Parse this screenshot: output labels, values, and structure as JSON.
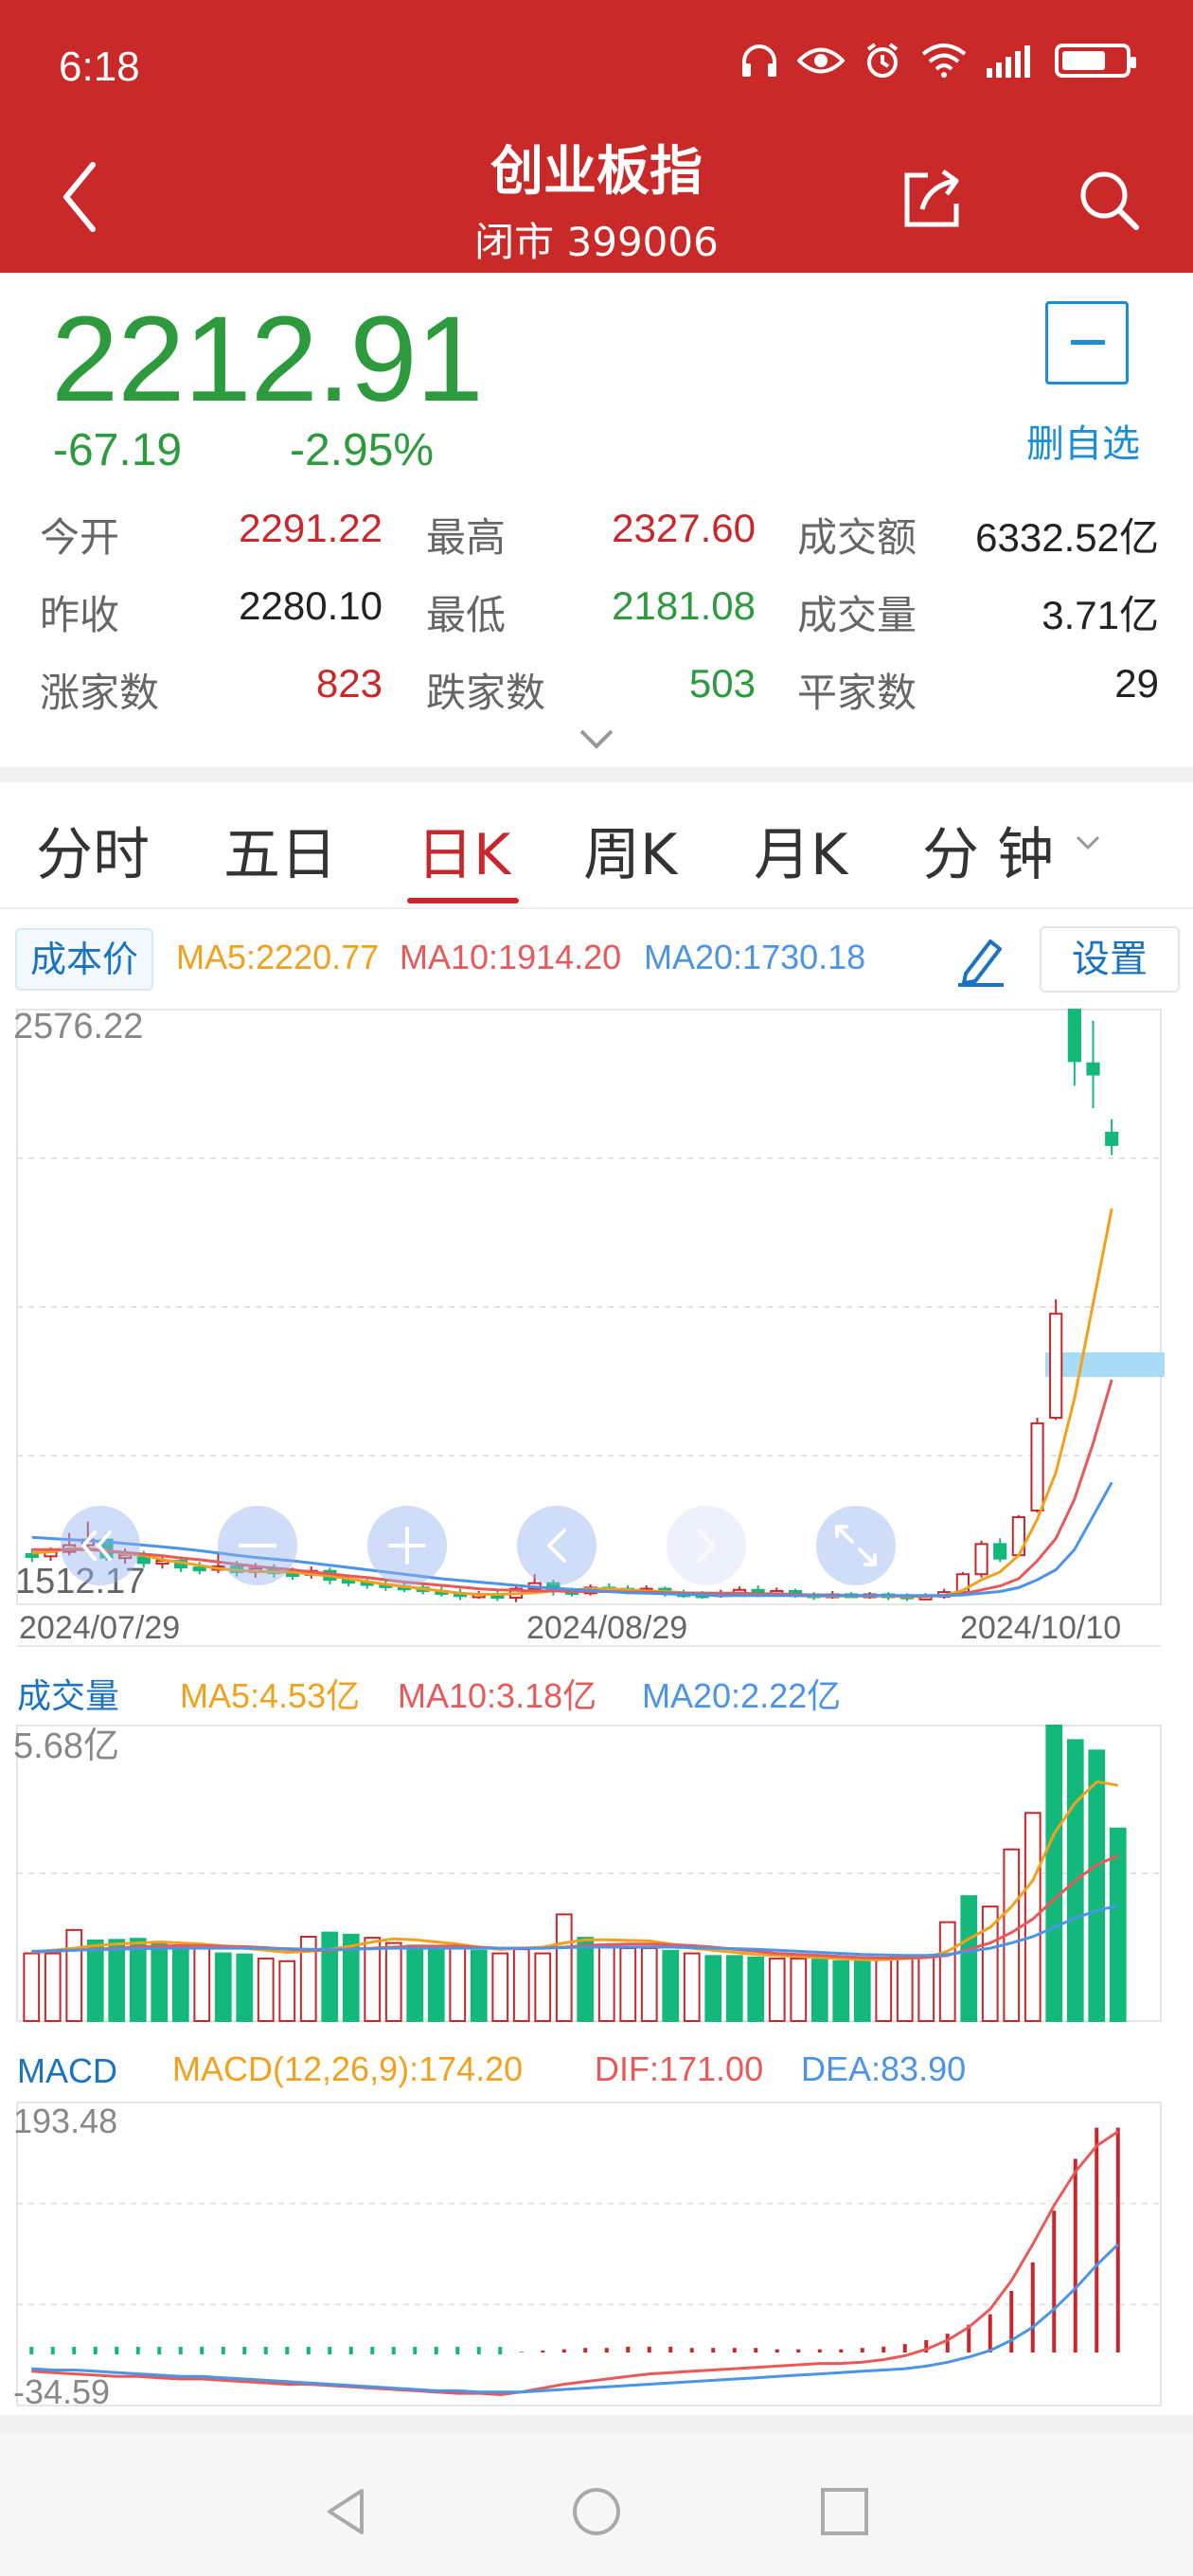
{
  "status": {
    "time": "6:18",
    "battery_level": 0.7
  },
  "nav": {
    "title": "创业板指",
    "subtitle": "闭市 399006",
    "back_icon": "chevron-left-icon",
    "share_icon": "share-icon",
    "search_icon": "search-icon"
  },
  "quote": {
    "price": "2212.91",
    "change": "-67.19",
    "change_pct": "-2.95%",
    "watch_label": "删自选"
  },
  "stats": [
    {
      "label": "今开",
      "value": "2291.22",
      "color": "#c8282c"
    },
    {
      "label": "最高",
      "value": "2327.60",
      "color": "#c8282c"
    },
    {
      "label": "成交额",
      "value": "6332.52亿",
      "color": "#222222"
    },
    {
      "label": "昨收",
      "value": "2280.10",
      "color": "#222222"
    },
    {
      "label": "最低",
      "value": "2181.08",
      "color": "#2e9a3e"
    },
    {
      "label": "成交量",
      "value": "3.71亿",
      "color": "#222222"
    },
    {
      "label": "涨家数",
      "value": "823",
      "color": "#c8282c"
    },
    {
      "label": "跌家数",
      "value": "503",
      "color": "#2e9a3e"
    },
    {
      "label": "平家数",
      "value": "29",
      "color": "#222222"
    }
  ],
  "tabs": [
    "分时",
    "五日",
    "日K",
    "周K",
    "月K",
    "分 钟"
  ],
  "active_tab": 2,
  "toolbar": {
    "cost_label": "成本价",
    "ma5": "MA5:2220.77",
    "ma10": "MA10:1914.20",
    "ma20": "MA20:1730.18",
    "settings_label": "设置"
  },
  "volume_header": {
    "label": "成交量",
    "ma5": "MA5:4.53亿",
    "ma10": "MA10:3.18亿",
    "ma20": "MA20:2.22亿"
  },
  "macd_header": {
    "label": "MACD",
    "macd": "MACD(12,26,9):174.20",
    "dif": "DIF:171.00",
    "dea": "DEA:83.90"
  },
  "colors": {
    "up": "#c8282c",
    "down": "#13b97a",
    "ma5": "#f2a11e",
    "ma10": "#e85a5a",
    "ma20": "#4b94e6",
    "header_bg": "#c92a29"
  },
  "chart_data": [
    {
      "type": "candlestick",
      "title": "",
      "y_max_label": "2576.22",
      "y_min_label": "1512.17",
      "ylim": [
        1512.17,
        2576.22
      ],
      "x_ticks": [
        "2024/07/29",
        "2024/08/29",
        "2024/10/10"
      ],
      "candles": [
        [
          1602,
          1598,
          1612,
          1588
        ],
        [
          1598,
          1606,
          1614,
          1590
        ],
        [
          1606,
          1618,
          1640,
          1600
        ],
        [
          1618,
          1628,
          1660,
          1610
        ],
        [
          1628,
          1596,
          1640,
          1590
        ],
        [
          1596,
          1600,
          1612,
          1585
        ],
        [
          1600,
          1586,
          1608,
          1578
        ],
        [
          1586,
          1590,
          1600,
          1576
        ],
        [
          1590,
          1578,
          1598,
          1570
        ],
        [
          1578,
          1574,
          1588,
          1566
        ],
        [
          1574,
          1580,
          1602,
          1568
        ],
        [
          1580,
          1570,
          1590,
          1562
        ],
        [
          1570,
          1576,
          1586,
          1560
        ],
        [
          1576,
          1568,
          1584,
          1560
        ],
        [
          1568,
          1565,
          1578,
          1556
        ],
        [
          1565,
          1572,
          1580,
          1558
        ],
        [
          1572,
          1556,
          1578,
          1548
        ],
        [
          1556,
          1552,
          1566,
          1544
        ],
        [
          1552,
          1548,
          1560,
          1540
        ],
        [
          1548,
          1544,
          1556,
          1536
        ],
        [
          1544,
          1542,
          1552,
          1534
        ],
        [
          1542,
          1536,
          1550,
          1530
        ],
        [
          1536,
          1532,
          1544,
          1526
        ],
        [
          1532,
          1528,
          1540,
          1520
        ],
        [
          1528,
          1530,
          1536,
          1522
        ],
        [
          1530,
          1524,
          1536,
          1518
        ],
        [
          1524,
          1540,
          1548,
          1516
        ],
        [
          1540,
          1550,
          1566,
          1534
        ],
        [
          1550,
          1536,
          1556,
          1528
        ],
        [
          1536,
          1532,
          1542,
          1526
        ],
        [
          1532,
          1542,
          1548,
          1528
        ],
        [
          1542,
          1540,
          1550,
          1534
        ],
        [
          1540,
          1536,
          1546,
          1530
        ],
        [
          1536,
          1540,
          1546,
          1532
        ],
        [
          1540,
          1532,
          1544,
          1526
        ],
        [
          1532,
          1530,
          1538,
          1524
        ],
        [
          1530,
          1528,
          1536,
          1522
        ],
        [
          1528,
          1532,
          1538,
          1524
        ],
        [
          1532,
          1538,
          1544,
          1526
        ],
        [
          1538,
          1532,
          1546,
          1528
        ],
        [
          1532,
          1536,
          1542,
          1528
        ],
        [
          1536,
          1530,
          1540,
          1524
        ],
        [
          1530,
          1526,
          1534,
          1520
        ],
        [
          1526,
          1530,
          1536,
          1522
        ],
        [
          1530,
          1528,
          1534,
          1524
        ],
        [
          1528,
          1530,
          1534,
          1522
        ],
        [
          1530,
          1528,
          1534,
          1520
        ],
        [
          1528,
          1524,
          1532,
          1518
        ],
        [
          1524,
          1526,
          1532,
          1520
        ],
        [
          1526,
          1534,
          1540,
          1522
        ],
        [
          1534,
          1566,
          1570,
          1530
        ],
        [
          1566,
          1620,
          1626,
          1560
        ],
        [
          1620,
          1594,
          1630,
          1588
        ],
        [
          1600,
          1668,
          1672,
          1598
        ],
        [
          1680,
          1836,
          1846,
          1676
        ],
        [
          1846,
          2032,
          2058,
          1842
        ],
        [
          2576,
          2484,
          2576,
          2440
        ],
        [
          2480,
          2460,
          2556,
          2400
        ],
        [
          2356,
          2334,
          2380,
          2316
        ]
      ],
      "series": [
        {
          "name": "MA5",
          "values": [
            1604,
            1606,
            1612,
            1612,
            1609,
            1602,
            1600,
            1592,
            1587,
            1582,
            1576,
            1573,
            1571,
            1570,
            1570,
            1566,
            1563,
            1558,
            1553,
            1548,
            1544,
            1540,
            1536,
            1532,
            1530,
            1530,
            1531,
            1533,
            1536,
            1538,
            1540,
            1540,
            1538,
            1536,
            1535,
            1533,
            1532,
            1531,
            1531,
            1530,
            1530,
            1528,
            1527,
            1527,
            1527,
            1527,
            1527,
            1526,
            1526,
            1528,
            1537,
            1556,
            1570,
            1600,
            1664,
            1748,
            1880,
            2050,
            2220
          ]
        },
        {
          "name": "MA10",
          "values": [
            1610,
            1610,
            1610,
            1610,
            1608,
            1605,
            1602,
            1599,
            1595,
            1592,
            1588,
            1584,
            1580,
            1577,
            1574,
            1570,
            1567,
            1563,
            1560,
            1556,
            1552,
            1549,
            1546,
            1543,
            1540,
            1538,
            1537,
            1536,
            1536,
            1535,
            1535,
            1535,
            1534,
            1534,
            1533,
            1532,
            1532,
            1532,
            1532,
            1531,
            1531,
            1530,
            1529,
            1529,
            1528,
            1528,
            1528,
            1527,
            1527,
            1528,
            1531,
            1538,
            1545,
            1558,
            1590,
            1630,
            1700,
            1800,
            1914
          ]
        },
        {
          "name": "MA20",
          "values": [
            1632,
            1630,
            1628,
            1626,
            1624,
            1621,
            1618,
            1615,
            1612,
            1608,
            1604,
            1600,
            1596,
            1593,
            1590,
            1586,
            1582,
            1578,
            1574,
            1570,
            1566,
            1562,
            1558,
            1555,
            1552,
            1549,
            1546,
            1543,
            1541,
            1539,
            1537,
            1535,
            1533,
            1532,
            1531,
            1530,
            1529,
            1528,
            1528,
            1528,
            1528,
            1528,
            1528,
            1528,
            1528,
            1528,
            1528,
            1528,
            1528,
            1528,
            1529,
            1532,
            1535,
            1542,
            1556,
            1574,
            1610,
            1670,
            1730
          ]
        }
      ],
      "overlay": "cost-band"
    },
    {
      "type": "bar",
      "title": "成交量",
      "y_max_label": "5.68亿",
      "ylim": [
        0,
        5.68
      ],
      "values": [
        1.3,
        1.3,
        1.75,
        1.55,
        1.56,
        1.58,
        1.5,
        1.45,
        1.4,
        1.3,
        1.28,
        1.2,
        1.15,
        1.62,
        1.7,
        1.66,
        1.6,
        1.5,
        1.45,
        1.4,
        1.4,
        1.35,
        1.3,
        1.38,
        1.3,
        2.05,
        1.6,
        1.42,
        1.4,
        1.4,
        1.35,
        1.3,
        1.25,
        1.25,
        1.22,
        1.2,
        1.2,
        1.18,
        1.15,
        1.15,
        1.2,
        1.22,
        1.25,
        1.9,
        2.4,
        2.2,
        3.3,
        4.0,
        5.68,
        5.4,
        5.2,
        3.7
      ],
      "colors_up": [
        1,
        1,
        1,
        0,
        0,
        0,
        0,
        0,
        1,
        0,
        0,
        1,
        1,
        1,
        0,
        0,
        1,
        1,
        0,
        0,
        1,
        0,
        1,
        1,
        1,
        1,
        0,
        1,
        1,
        1,
        0,
        1,
        0,
        0,
        0,
        1,
        1,
        0,
        0,
        0,
        1,
        1,
        1,
        1,
        0,
        1,
        1,
        1,
        0,
        0,
        0,
        0
      ],
      "series": [
        {
          "name": "MA5",
          "values": [
            1.32,
            1.36,
            1.4,
            1.45,
            1.48,
            1.5,
            1.52,
            1.5,
            1.48,
            1.44,
            1.4,
            1.36,
            1.32,
            1.34,
            1.38,
            1.44,
            1.52,
            1.58,
            1.56,
            1.52,
            1.48,
            1.42,
            1.38,
            1.4,
            1.42,
            1.5,
            1.56,
            1.56,
            1.55,
            1.54,
            1.48,
            1.4,
            1.36,
            1.32,
            1.28,
            1.26,
            1.24,
            1.22,
            1.2,
            1.18,
            1.18,
            1.2,
            1.22,
            1.34,
            1.58,
            1.8,
            2.2,
            2.7,
            3.6,
            4.2,
            4.6,
            4.53
          ]
        },
        {
          "name": "MA10",
          "values": [
            1.32,
            1.34,
            1.36,
            1.38,
            1.4,
            1.42,
            1.44,
            1.45,
            1.45,
            1.44,
            1.43,
            1.41,
            1.38,
            1.36,
            1.36,
            1.38,
            1.4,
            1.42,
            1.44,
            1.44,
            1.44,
            1.42,
            1.4,
            1.4,
            1.4,
            1.42,
            1.45,
            1.47,
            1.48,
            1.48,
            1.47,
            1.45,
            1.42,
            1.38,
            1.34,
            1.3,
            1.28,
            1.26,
            1.24,
            1.22,
            1.21,
            1.21,
            1.22,
            1.26,
            1.38,
            1.5,
            1.7,
            1.96,
            2.34,
            2.7,
            3.0,
            3.18
          ]
        },
        {
          "name": "MA20",
          "values": [
            1.34,
            1.35,
            1.36,
            1.37,
            1.38,
            1.39,
            1.4,
            1.4,
            1.4,
            1.4,
            1.4,
            1.4,
            1.39,
            1.38,
            1.38,
            1.38,
            1.39,
            1.4,
            1.4,
            1.4,
            1.4,
            1.4,
            1.4,
            1.4,
            1.4,
            1.41,
            1.42,
            1.42,
            1.42,
            1.42,
            1.42,
            1.41,
            1.4,
            1.39,
            1.38,
            1.36,
            1.34,
            1.32,
            1.3,
            1.28,
            1.27,
            1.26,
            1.26,
            1.28,
            1.34,
            1.4,
            1.5,
            1.62,
            1.8,
            1.98,
            2.12,
            2.22
          ]
        }
      ]
    },
    {
      "type": "bar",
      "title": "MACD",
      "y_max_label": "193.48",
      "y_min_label": "-34.59",
      "ylim": [
        -34.59,
        193.48
      ],
      "histogram": [
        -6,
        -7,
        -8,
        -8,
        -7,
        -6,
        -5,
        -5,
        -4,
        -4,
        -3,
        -3,
        -3,
        -2,
        -2,
        -2,
        -2,
        -2,
        -2,
        -2,
        -2,
        -1,
        -1,
        1,
        2,
        3,
        4,
        4,
        5,
        5,
        5,
        4,
        4,
        4,
        4,
        3,
        3,
        3,
        3,
        4,
        5,
        7,
        10,
        15,
        22,
        30,
        48,
        70,
        110,
        150,
        174,
        174
      ],
      "series": [
        {
          "name": "DIF",
          "values": [
            -14,
            -15,
            -16,
            -17,
            -18,
            -18,
            -19,
            -20,
            -20,
            -21,
            -22,
            -23,
            -24,
            -24,
            -25,
            -26,
            -27,
            -28,
            -29,
            -30,
            -31,
            -31,
            -32,
            -30,
            -27,
            -24,
            -22,
            -20,
            -18,
            -16,
            -15,
            -14,
            -13,
            -12,
            -11,
            -10,
            -9,
            -8,
            -8,
            -7,
            -5,
            -2,
            3,
            10,
            20,
            34,
            56,
            84,
            114,
            140,
            160,
            171
          ]
        },
        {
          "name": "DEA",
          "values": [
            -12,
            -13,
            -13,
            -14,
            -15,
            -16,
            -17,
            -18,
            -18,
            -19,
            -20,
            -21,
            -22,
            -23,
            -24,
            -25,
            -26,
            -27,
            -28,
            -29,
            -29,
            -30,
            -30,
            -30,
            -29,
            -28,
            -27,
            -26,
            -25,
            -24,
            -23,
            -22,
            -21,
            -20,
            -19,
            -18,
            -17,
            -16,
            -15,
            -14,
            -13,
            -12,
            -10,
            -7,
            -3,
            2,
            10,
            20,
            34,
            50,
            68,
            84
          ]
        }
      ]
    }
  ]
}
